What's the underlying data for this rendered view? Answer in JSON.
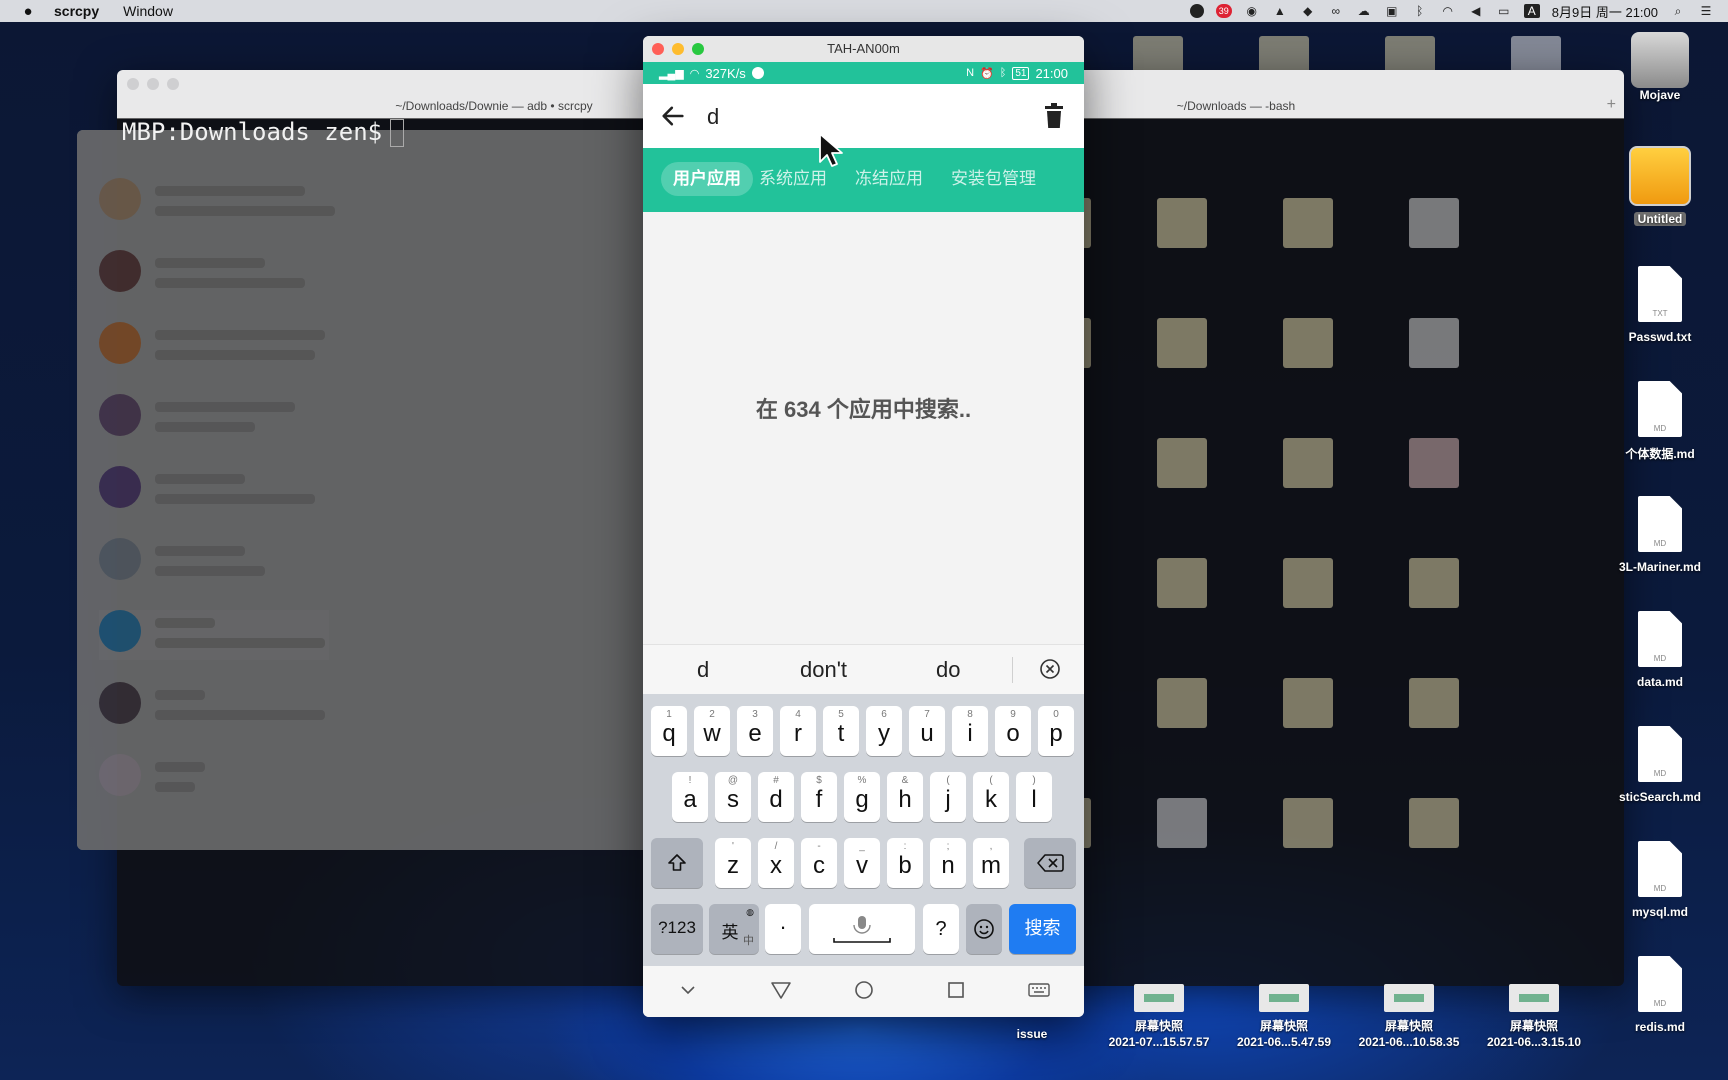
{
  "menubar": {
    "app_name": "scrcpy",
    "menu_items": [
      "Window"
    ],
    "datetime": "8月9日 周一 21:00",
    "tray_badge": "39"
  },
  "terminal": {
    "tab_left": "~/Downloads/Downie — adb • scrcpy",
    "tab_right": "~/Downloads — -bash",
    "prompt": "MBP:Downloads zen$"
  },
  "phone": {
    "window_title": "TAH-AN00m",
    "status": {
      "speed": "327K/s",
      "battery": "51",
      "time": "21:00"
    },
    "search_query": "d",
    "tabs": [
      {
        "label": "用户应用",
        "active": true
      },
      {
        "label": "系统应用",
        "active": false
      },
      {
        "label": "冻结应用",
        "active": false
      },
      {
        "label": "安装包管理",
        "active": false
      }
    ],
    "hint": "在 634 个应用中搜索..",
    "suggestions": [
      "d",
      "don't",
      "do"
    ],
    "keyboard": {
      "row1": [
        {
          "k": "q",
          "s": "1"
        },
        {
          "k": "w",
          "s": "2"
        },
        {
          "k": "e",
          "s": "3"
        },
        {
          "k": "r",
          "s": "4"
        },
        {
          "k": "t",
          "s": "5"
        },
        {
          "k": "y",
          "s": "6"
        },
        {
          "k": "u",
          "s": "7"
        },
        {
          "k": "i",
          "s": "8"
        },
        {
          "k": "o",
          "s": "9"
        },
        {
          "k": "p",
          "s": "0"
        }
      ],
      "row2": [
        {
          "k": "a",
          "s": "!"
        },
        {
          "k": "s",
          "s": "@"
        },
        {
          "k": "d",
          "s": "#"
        },
        {
          "k": "f",
          "s": "$"
        },
        {
          "k": "g",
          "s": "%"
        },
        {
          "k": "h",
          "s": "&"
        },
        {
          "k": "j",
          "s": "("
        },
        {
          "k": "k",
          "s": "("
        },
        {
          "k": "l",
          "s": ")"
        }
      ],
      "row3": [
        {
          "k": "z",
          "s": "'"
        },
        {
          "k": "x",
          "s": "/"
        },
        {
          "k": "c",
          "s": "-"
        },
        {
          "k": "v",
          "s": "_"
        },
        {
          "k": "b",
          "s": ":"
        },
        {
          "k": "n",
          "s": ";"
        },
        {
          "k": "m",
          "s": ","
        }
      ],
      "num_key": "?123",
      "lang_key": "英",
      "lang_sub": "中",
      "dot_key": "·",
      "question_key": "?",
      "search_key": "搜索"
    }
  },
  "desktop": {
    "right_icons": [
      {
        "label": "Mojave",
        "kind": "disk"
      },
      {
        "label": "Untitled",
        "kind": "drive"
      },
      {
        "label": "Passwd.txt",
        "ext": "TXT"
      },
      {
        "label": "个体数据.md",
        "ext": "MD"
      },
      {
        "label": "3L-Mariner.md",
        "ext": "MD"
      },
      {
        "label": "data.md",
        "ext": "MD"
      },
      {
        "label": "sticSearch.md",
        "ext": "MD"
      },
      {
        "label": "mysql.md",
        "ext": "MD"
      },
      {
        "label": "redis.md",
        "ext": "MD"
      }
    ],
    "bottom_items": [
      {
        "label": "issue"
      },
      {
        "label": "屏幕快照",
        "sub": "2021-07...15.57.57"
      },
      {
        "label": "屏幕快照",
        "sub": "2021-06...5.47.59"
      },
      {
        "label": "屏幕快照",
        "sub": "2021-06...10.58.35"
      },
      {
        "label": "屏幕快照",
        "sub": "2021-06...3.15.10"
      }
    ]
  },
  "colors": {
    "accent": "#22c29a",
    "search_key": "#1f7cf2"
  }
}
